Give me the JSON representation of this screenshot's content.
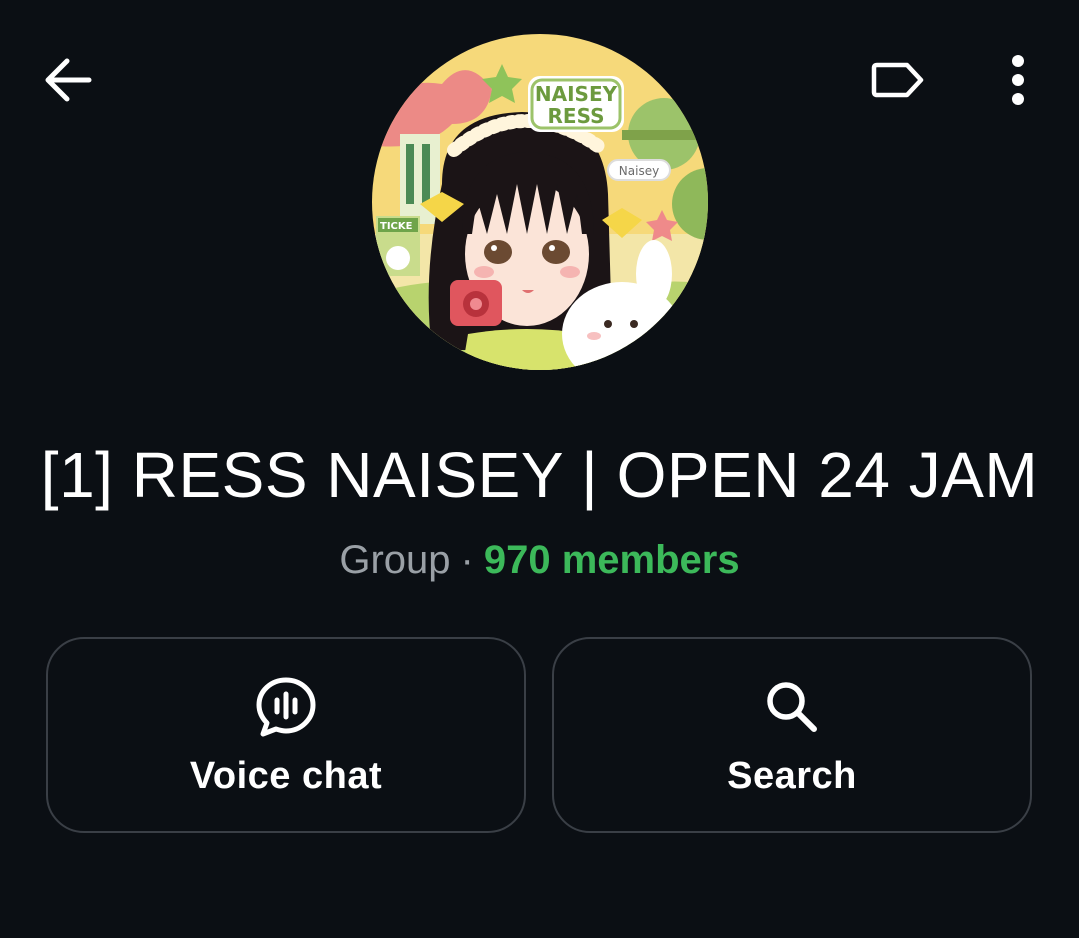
{
  "header": {
    "back_icon": "arrow-left-icon",
    "tag_icon": "label-tag-icon",
    "more_icon": "more-vertical-icon"
  },
  "avatar": {
    "badge_line1": "NAISEY",
    "badge_line2": "RESS",
    "name_tag": "Naisey",
    "ticket_text": "TICKE"
  },
  "profile": {
    "title": "[1] RESS NAISEY | OPEN 24 JAM",
    "type_label": "Group",
    "separator": "·",
    "members": "970 members"
  },
  "actions": {
    "voice_chat": {
      "label": "Voice chat",
      "icon": "voice-chat-icon"
    },
    "search": {
      "label": "Search",
      "icon": "search-icon"
    }
  },
  "colors": {
    "background": "#0b0f14",
    "members_accent": "#3cb95a",
    "muted_text": "#9aa0a6",
    "button_border": "#3a3f46"
  }
}
